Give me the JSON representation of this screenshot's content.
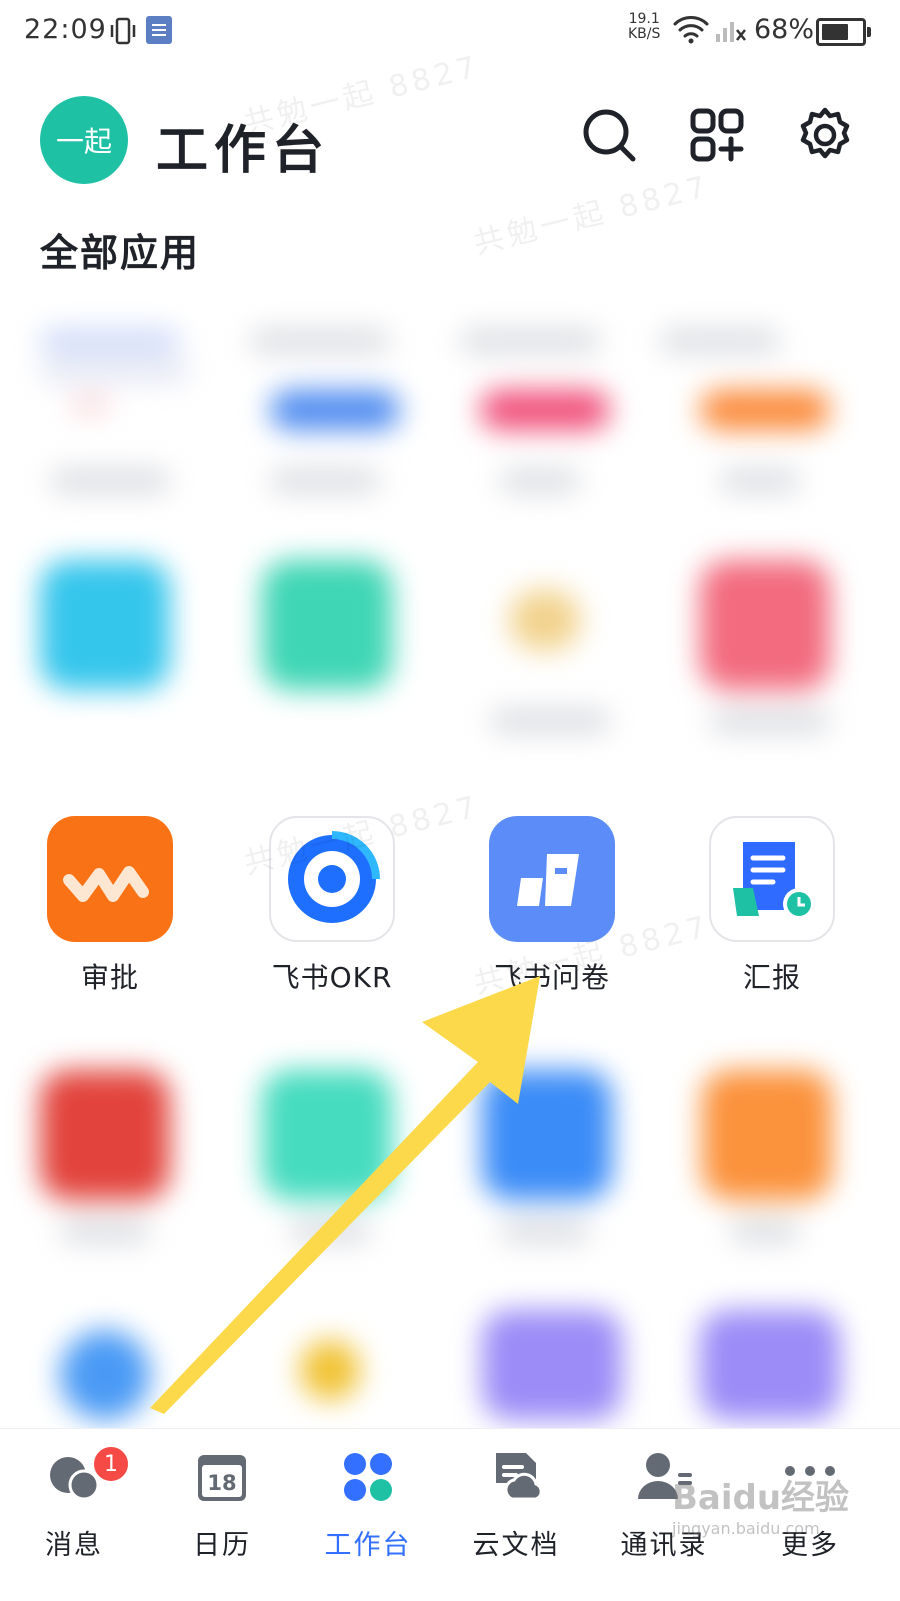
{
  "status_bar": {
    "time": "22:09",
    "speed_value": "19.1",
    "speed_unit": "KB/S",
    "battery": "68%",
    "battery_level": 0.68
  },
  "header": {
    "avatar_text": "一起",
    "title": "工作台",
    "search_icon": "search-icon",
    "apps_icon": "app-grid-add-icon",
    "settings_icon": "gear-icon"
  },
  "section_title": "全部应用",
  "apps": [
    {
      "label": "审批",
      "icon": "approval-icon",
      "color": "#f97316"
    },
    {
      "label": "飞书OKR",
      "icon": "okr-target-icon",
      "color": "#1f6fff"
    },
    {
      "label": "飞书问卷",
      "icon": "survey-icon",
      "color": "#5b8cf7"
    },
    {
      "label": "汇报",
      "icon": "report-icon",
      "color": "#2f6bff"
    }
  ],
  "watermark": "共勉一起 8827",
  "tabbar": {
    "items": [
      {
        "label": "消息",
        "icon": "chat-bubbles-icon",
        "badge": "1"
      },
      {
        "label": "日历",
        "icon": "calendar-icon",
        "date": "18"
      },
      {
        "label": "工作台",
        "icon": "workspace-icon",
        "active": true
      },
      {
        "label": "云文档",
        "icon": "cloud-doc-icon"
      },
      {
        "label": "通讯录",
        "icon": "contacts-icon"
      },
      {
        "label": "更多",
        "icon": "more-dots-icon"
      }
    ]
  },
  "baidu_watermark": {
    "brand": "Baidu经验",
    "url": "jingyan.baidu.com"
  },
  "colors": {
    "accent": "#3370ff",
    "avatar": "#1fc1a5",
    "arrow": "#fcd94a"
  }
}
